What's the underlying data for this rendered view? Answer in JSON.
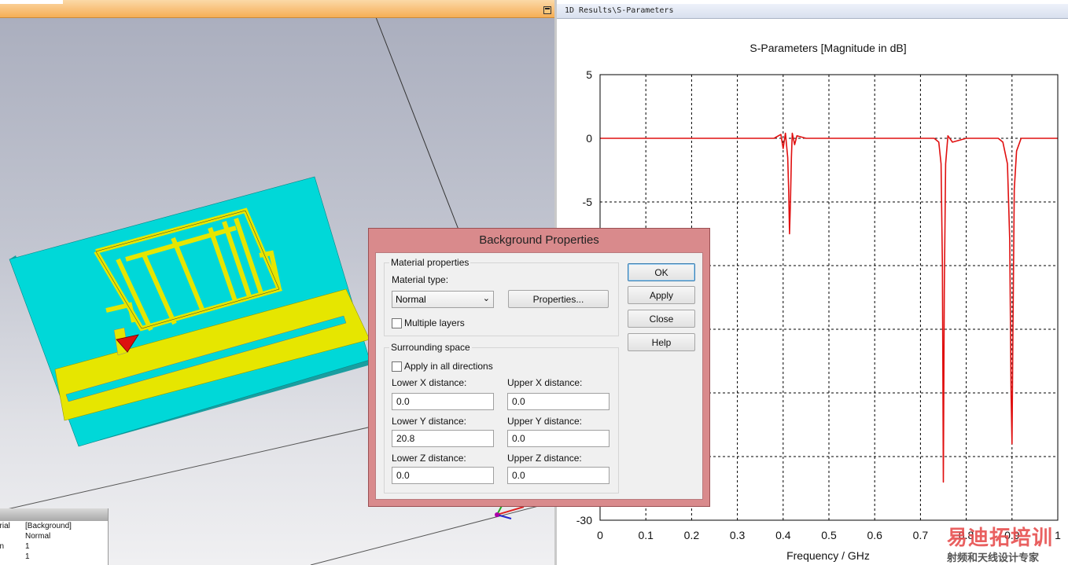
{
  "results_tab": {
    "title": "1D Results\\S-Parameters"
  },
  "properties_panel": {
    "rows": [
      {
        "key": "erial",
        "value": "[Background]"
      },
      {
        "key": "e",
        "value": "Normal"
      },
      {
        "key": "on",
        "value": "1"
      },
      {
        "key": "",
        "value": "1"
      }
    ]
  },
  "dialog": {
    "title": "Background Properties",
    "material_group": "Material properties",
    "material_type_label": "Material type:",
    "material_type_value": "Normal",
    "properties_button": "Properties...",
    "multiple_layers_label": "Multiple layers",
    "surrounding_group": "Surrounding space",
    "apply_all_label": "Apply in all directions",
    "lower_x_label": "Lower X distance:",
    "upper_x_label": "Upper X distance:",
    "lower_y_label": "Lower Y distance:",
    "upper_y_label": "Upper Y distance:",
    "lower_z_label": "Lower Z distance:",
    "upper_z_label": "Upper Z distance:",
    "lower_x_value": "0.0",
    "upper_x_value": "0.0",
    "lower_y_value": "20.8",
    "upper_y_value": "0.0",
    "lower_z_value": "0.0",
    "upper_z_value": "0.0",
    "ok_button": "OK",
    "apply_button": "Apply",
    "close_button": "Close",
    "help_button": "Help"
  },
  "watermark": {
    "line1": "易迪拓培训",
    "line2": "射频和天线设计专家"
  },
  "colors": {
    "curve": "#e01010",
    "substrate": "#00d8d8",
    "copper": "#e6e600"
  },
  "chart_data": {
    "type": "line",
    "title": "S-Parameters [Magnitude in dB]",
    "xlabel": "Frequency / GHz",
    "ylabel": "",
    "xlim": [
      0,
      1
    ],
    "ylim": [
      -30,
      5
    ],
    "x_ticks": [
      0,
      0.1,
      0.2,
      0.3,
      0.4,
      0.5,
      0.6,
      0.7,
      0.8,
      0.9,
      1
    ],
    "x_tick_labels": [
      "0",
      "0.1",
      "0.2",
      "0.3",
      "0.4",
      "0.5",
      "0.6",
      "0.7",
      "0.8",
      "0.9",
      "1"
    ],
    "y_ticks": [
      5,
      0,
      -5,
      -10,
      -15,
      -20,
      -25,
      -30
    ],
    "y_tick_labels": [
      "5",
      "0",
      "-5",
      "",
      "",
      "",
      "",
      "-30"
    ],
    "grid": true,
    "series": [
      {
        "x": [
          0,
          0.2,
          0.3,
          0.38,
          0.395,
          0.4,
          0.405,
          0.41,
          0.412,
          0.414,
          0.416,
          0.418,
          0.42,
          0.425,
          0.43,
          0.45,
          0.5,
          0.6,
          0.7,
          0.73,
          0.74,
          0.745,
          0.748,
          0.75,
          0.752,
          0.755,
          0.76,
          0.77,
          0.8,
          0.85,
          0.87,
          0.88,
          0.89,
          0.895,
          0.898,
          0.9,
          0.902,
          0.905,
          0.91,
          0.92,
          0.95,
          1
        ],
        "y": [
          0,
          0,
          0,
          0,
          0.3,
          -0.8,
          0.4,
          -1.5,
          -4,
          -7.5,
          -5,
          -1.5,
          0.4,
          -0.5,
          0.2,
          0,
          0,
          0,
          0,
          0,
          -0.3,
          -2,
          -10,
          -27,
          -12,
          -2,
          0.2,
          -0.3,
          0,
          0,
          0,
          -0.3,
          -2,
          -8,
          -20,
          -24,
          -15,
          -4,
          -1,
          0,
          0,
          0
        ]
      }
    ]
  }
}
